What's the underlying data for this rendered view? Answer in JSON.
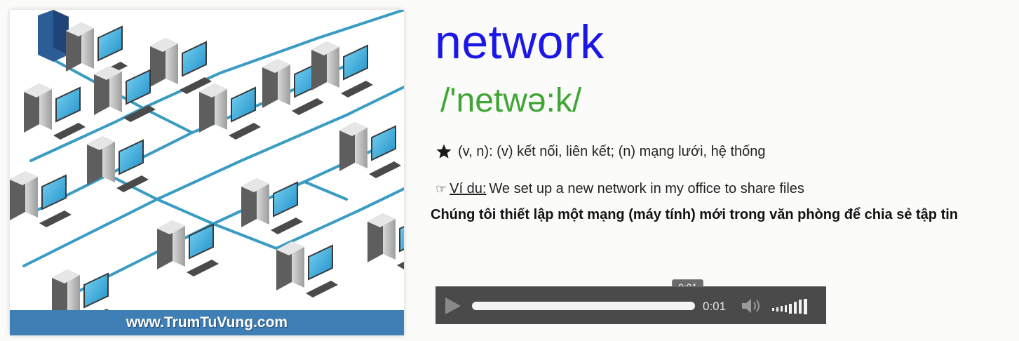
{
  "image_card": {
    "caption": "www.TrumTuVung.com"
  },
  "entry": {
    "word": "network",
    "pronunciation": "/'netwə:k/",
    "meaning_icon": "star-icon",
    "meaning": "(v, n): (v) kết nối, liên kết; (n) mạng lưới, hệ thống",
    "example_icon": "pointing-hand-icon",
    "example_label": "Ví du:",
    "example_text": "We set up a new network in my office to share files",
    "translation": "Chúng tôi thiết lập một mạng (máy tính) mới trong văn phòng để chia sẻ tập tin"
  },
  "audio_player": {
    "tooltip_time": "0:01",
    "current_time": "0:01",
    "progress": 1.0,
    "icons": [
      "play-icon",
      "volume-icon",
      "volume-level-icon"
    ]
  },
  "colors": {
    "word": "#1b17e6",
    "pronunciation": "#3fa535",
    "caption_bar": "#3f7fb6",
    "player_bg": "#4a4a4a"
  }
}
